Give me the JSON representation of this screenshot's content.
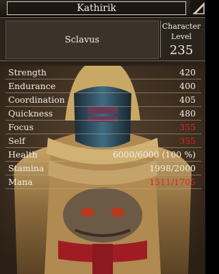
{
  "window": {
    "title": "Kathirik"
  },
  "character": {
    "name": "Sclavus",
    "level_label_line1": "Character",
    "level_label_line2": "Level",
    "level": "235"
  },
  "stats": [
    {
      "label": "Strength",
      "value": "420",
      "highlight": false
    },
    {
      "label": "Endurance",
      "value": "400",
      "highlight": false
    },
    {
      "label": "Coordination",
      "value": "405",
      "highlight": false
    },
    {
      "label": "Quickness",
      "value": "480",
      "highlight": false
    },
    {
      "label": "Focus",
      "value": "355",
      "highlight": true
    },
    {
      "label": "Self",
      "value": "355",
      "highlight": true
    },
    {
      "label": "Health",
      "value": "6000/6000 (100 %)",
      "highlight": false
    },
    {
      "label": "Stamina",
      "value": "1998/2000",
      "highlight": false
    },
    {
      "label": "Mana",
      "value": "1511/1705",
      "highlight": true
    }
  ],
  "colors": {
    "highlight": "#e02525",
    "text": "#f3efe8",
    "panel": "#2a241d"
  },
  "icons": {
    "corner": "corner-ornament-icon"
  }
}
